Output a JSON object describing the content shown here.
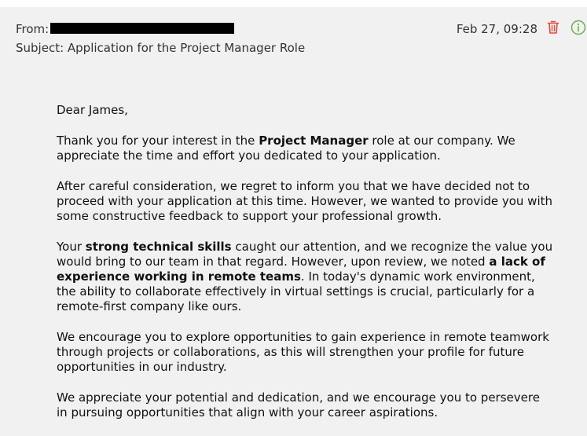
{
  "email": {
    "from_label": "From:",
    "subject": "Subject: Application for the Project Manager Role",
    "date": "Feb 27, 09:28",
    "colors": {
      "trash": "#e24b3b",
      "info": "#6bb04a",
      "redaction": "#000000"
    },
    "icons": {
      "delete": "trash-icon",
      "details": "info-icon"
    }
  },
  "letter": {
    "greeting": "Dear James,",
    "p1": {
      "a": "Thank you for your interest in the ",
      "b": "Project Manager",
      "c": " role at our company. We appreciate the time and effort you dedicated to your application."
    },
    "p2": "After careful consideration, we regret to inform you that we have decided not to proceed with your application at this time. However, we wanted to provide you with some constructive feedback to support your professional growth.",
    "p3": {
      "a": "Your ",
      "b": "strong technical skills",
      "c": " caught our attention, and we recognize the value you would bring to our team in that regard. However, upon review, we noted ",
      "d": "a lack of experience working in remote teams",
      "e": ". In today's dynamic work environment, the ability to collaborate effectively in virtual settings is crucial, particularly for a remote-first company like ours."
    },
    "p4": "We encourage you to explore opportunities to gain experience in remote teamwork through projects or collaborations, as this will strengthen your profile for future opportunities in our industry.",
    "p5": "We appreciate your potential and dedication, and we encourage you to persevere in pursuing opportunities that align with your career aspirations."
  }
}
